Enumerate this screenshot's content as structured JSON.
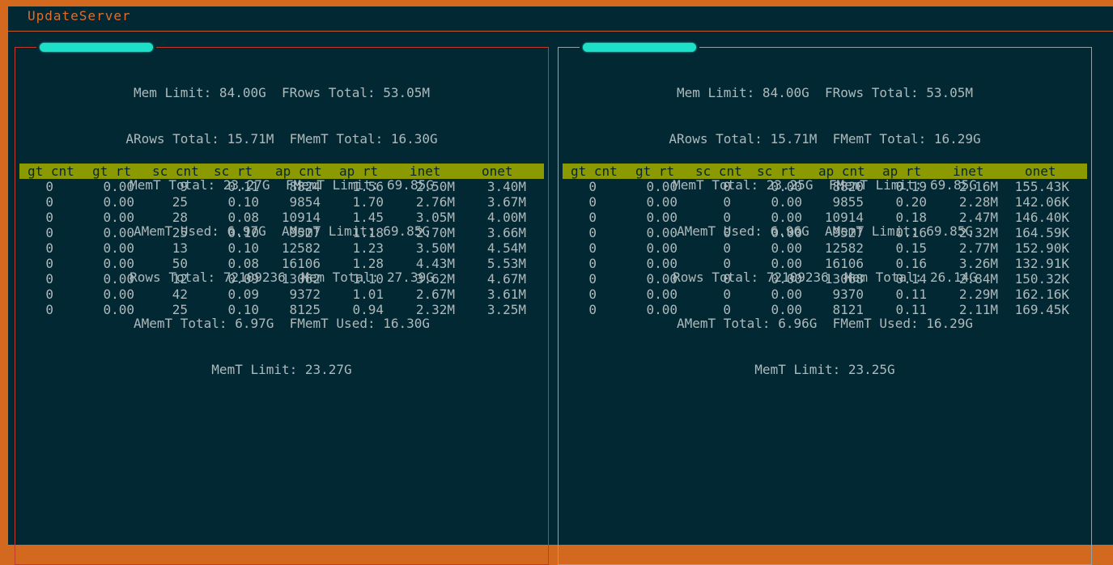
{
  "app": {
    "title": "UpdateServer"
  },
  "columns": [
    "gt cnt",
    "gt rt",
    "sc cnt",
    "sc rt",
    "ap cnt",
    "ap rt",
    "inet",
    "onet"
  ],
  "panels": [
    {
      "stats_lines": [
        "Mem Limit: 84.00G  FRows Total: 53.05M",
        "ARows Total: 15.71M  FMemT Total: 16.30G",
        "MemT Total: 23.27G  FMemT Limit: 69.85G",
        "AMemT Used: 6.97G  AMemT Limit: 69.85G",
        "Rows Total: 72109236  Mem Total: 27.39G",
        "AMemT Total: 6.97G  FMemT Used: 16.30G",
        "MemT Limit: 23.27G"
      ],
      "rows": [
        [
          "0",
          "0.00",
          "9",
          "0.11",
          "8824",
          "1.56",
          "2.50M",
          "3.40M"
        ],
        [
          "0",
          "0.00",
          "25",
          "0.10",
          "9854",
          "1.70",
          "2.76M",
          "3.67M"
        ],
        [
          "0",
          "0.00",
          "28",
          "0.08",
          "10914",
          "1.45",
          "3.05M",
          "4.00M"
        ],
        [
          "0",
          "0.00",
          "25",
          "0.10",
          "9527",
          "1.18",
          "2.70M",
          "3.66M"
        ],
        [
          "0",
          "0.00",
          "13",
          "0.10",
          "12582",
          "1.23",
          "3.50M",
          "4.54M"
        ],
        [
          "0",
          "0.00",
          "50",
          "0.08",
          "16106",
          "1.28",
          "4.43M",
          "5.53M"
        ],
        [
          "0",
          "0.00",
          "12",
          "0.09",
          "13062",
          "1.10",
          "3.62M",
          "4.67M"
        ],
        [
          "0",
          "0.00",
          "42",
          "0.09",
          "9372",
          "1.01",
          "2.67M",
          "3.61M"
        ],
        [
          "0",
          "0.00",
          "25",
          "0.10",
          "8125",
          "0.94",
          "2.32M",
          "3.25M"
        ]
      ]
    },
    {
      "stats_lines": [
        "Mem Limit: 84.00G  FRows Total: 53.05M",
        "ARows Total: 15.71M  FMemT Total: 16.29G",
        "MemT Total: 23.25G  FMemT Limit: 69.85G",
        "AMemT Used: 6.96G  AMemT Limit: 69.85G",
        "Rows Total: 72109236  Mem Total: 26.14G",
        "AMemT Total: 6.96G  FMemT Used: 16.29G",
        "MemT Limit: 23.25G"
      ],
      "rows": [
        [
          "0",
          "0.00",
          "0",
          "0.00",
          "8820",
          "0.19",
          "2.16M",
          "155.43K"
        ],
        [
          "0",
          "0.00",
          "0",
          "0.00",
          "9855",
          "0.20",
          "2.28M",
          "142.06K"
        ],
        [
          "0",
          "0.00",
          "0",
          "0.00",
          "10914",
          "0.18",
          "2.47M",
          "146.40K"
        ],
        [
          "0",
          "0.00",
          "0",
          "0.00",
          "9527",
          "0.16",
          "2.32M",
          "164.59K"
        ],
        [
          "0",
          "0.00",
          "0",
          "0.00",
          "12582",
          "0.15",
          "2.77M",
          "152.90K"
        ],
        [
          "0",
          "0.00",
          "0",
          "0.00",
          "16106",
          "0.16",
          "3.26M",
          "132.91K"
        ],
        [
          "0",
          "0.00",
          "0",
          "0.00",
          "13068",
          "0.14",
          "2.84M",
          "150.32K"
        ],
        [
          "0",
          "0.00",
          "0",
          "0.00",
          "9370",
          "0.11",
          "2.29M",
          "162.16K"
        ],
        [
          "0",
          "0.00",
          "0",
          "0.00",
          "8121",
          "0.11",
          "2.11M",
          "169.45K"
        ]
      ]
    }
  ],
  "colors": {
    "background": "#022833",
    "frame": "#d2691e",
    "title": "#e06c2a",
    "header_bar": "#8a9a00",
    "text": "#aeb9bb",
    "redaction": "#1de0c8"
  }
}
